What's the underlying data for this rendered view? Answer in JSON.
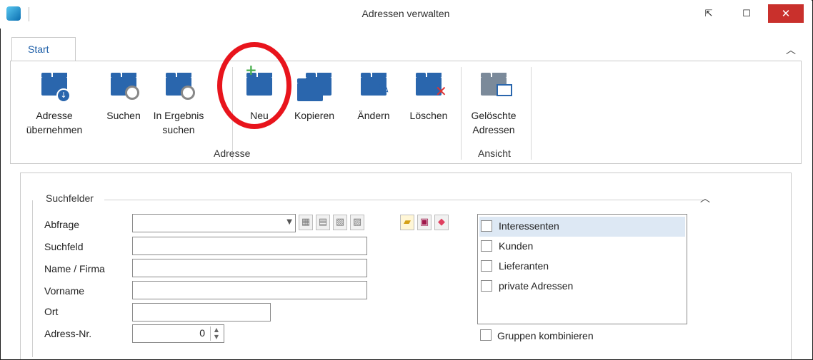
{
  "window": {
    "title": "Adressen verwalten",
    "close_glyph": "✕",
    "maximize_glyph": "☐",
    "pin_glyph": "⇱"
  },
  "tabs": {
    "active": "Start"
  },
  "ribbon": {
    "groups": [
      {
        "label": "Adresse"
      },
      {
        "label": "Ansicht"
      }
    ],
    "buttons": [
      {
        "label": "Adresse\nübernehmen",
        "icon": "folder-download-icon"
      },
      {
        "label": "Suchen",
        "icon": "folder-search-icon"
      },
      {
        "label": "In Ergebnis\nsuchen",
        "icon": "folder-search-refresh-icon"
      },
      {
        "label": "Neu",
        "icon": "folder-add-icon"
      },
      {
        "label": "Kopieren",
        "icon": "folder-copy-icon"
      },
      {
        "label": "Ändern",
        "icon": "folder-edit-icon"
      },
      {
        "label": "Löschen",
        "icon": "folder-delete-icon"
      },
      {
        "label": "Gelöschte\nAdressen",
        "icon": "folder-monitor-icon"
      }
    ]
  },
  "search": {
    "legend": "Suchfelder",
    "fields": {
      "abfrage": {
        "label": "Abfrage",
        "value": ""
      },
      "suchfeld": {
        "label": "Suchfeld",
        "value": ""
      },
      "name": {
        "label": "Name / Firma",
        "value": ""
      },
      "vorname": {
        "label": "Vorname",
        "value": ""
      },
      "ort": {
        "label": "Ort",
        "value": ""
      },
      "adressnr": {
        "label": "Adress-Nr.",
        "value": "0"
      }
    },
    "categories": [
      {
        "label": "Interessenten",
        "checked": false,
        "selected": true
      },
      {
        "label": "Kunden",
        "checked": false
      },
      {
        "label": "Lieferanten",
        "checked": false
      },
      {
        "label": "private Adressen",
        "checked": false
      }
    ],
    "combine_groups": {
      "label": "Gruppen kombinieren",
      "checked": false
    }
  },
  "colors": {
    "accent": "#2a66ad",
    "highlight": "#e8141c",
    "close": "#c9302c"
  }
}
